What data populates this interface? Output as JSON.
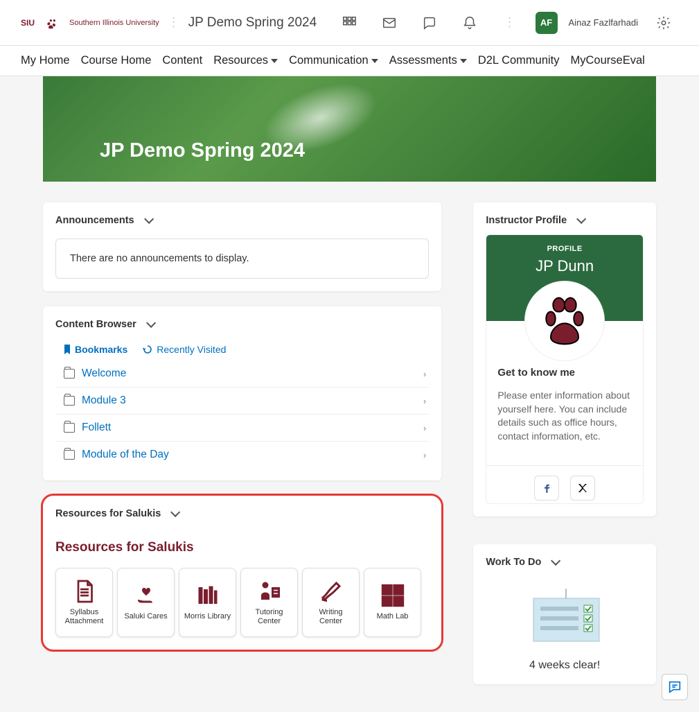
{
  "header": {
    "org": "Southern Illinois University",
    "course": "JP Demo Spring 2024",
    "user_initials": "AF",
    "user_name": "Ainaz Fazlfarhadi"
  },
  "nav": {
    "items": [
      {
        "label": "My Home",
        "dropdown": false
      },
      {
        "label": "Course Home",
        "dropdown": false
      },
      {
        "label": "Content",
        "dropdown": false
      },
      {
        "label": "Resources",
        "dropdown": true
      },
      {
        "label": "Communication",
        "dropdown": true
      },
      {
        "label": "Assessments",
        "dropdown": true
      },
      {
        "label": "D2L Community",
        "dropdown": false
      },
      {
        "label": "MyCourseEval",
        "dropdown": false
      }
    ]
  },
  "banner": {
    "title": "JP Demo Spring 2024"
  },
  "announcements": {
    "title": "Announcements",
    "empty_text": "There are no announcements to display."
  },
  "content_browser": {
    "title": "Content Browser",
    "tab_bookmarks": "Bookmarks",
    "tab_recent": "Recently Visited",
    "items": [
      {
        "label": "Welcome"
      },
      {
        "label": "Module 3"
      },
      {
        "label": "Follett"
      },
      {
        "label": "Module of the Day"
      }
    ]
  },
  "resources": {
    "widget_title": "Resources for Salukis",
    "heading": "Resources for Salukis",
    "tiles": [
      {
        "label": "Syllabus Attachment"
      },
      {
        "label": "Saluki Cares"
      },
      {
        "label": "Morris Library"
      },
      {
        "label": "Tutoring Center"
      },
      {
        "label": "Writing Center"
      },
      {
        "label": "Math Lab"
      }
    ]
  },
  "instructor": {
    "title": "Instructor Profile",
    "label": "PROFILE",
    "name": "JP Dunn",
    "know_me": "Get to know me",
    "bio": "Please enter information about yourself here. You can include details such as office hours, contact information, etc."
  },
  "work_to_do": {
    "title": "Work To Do",
    "status": "4 weeks clear!"
  }
}
